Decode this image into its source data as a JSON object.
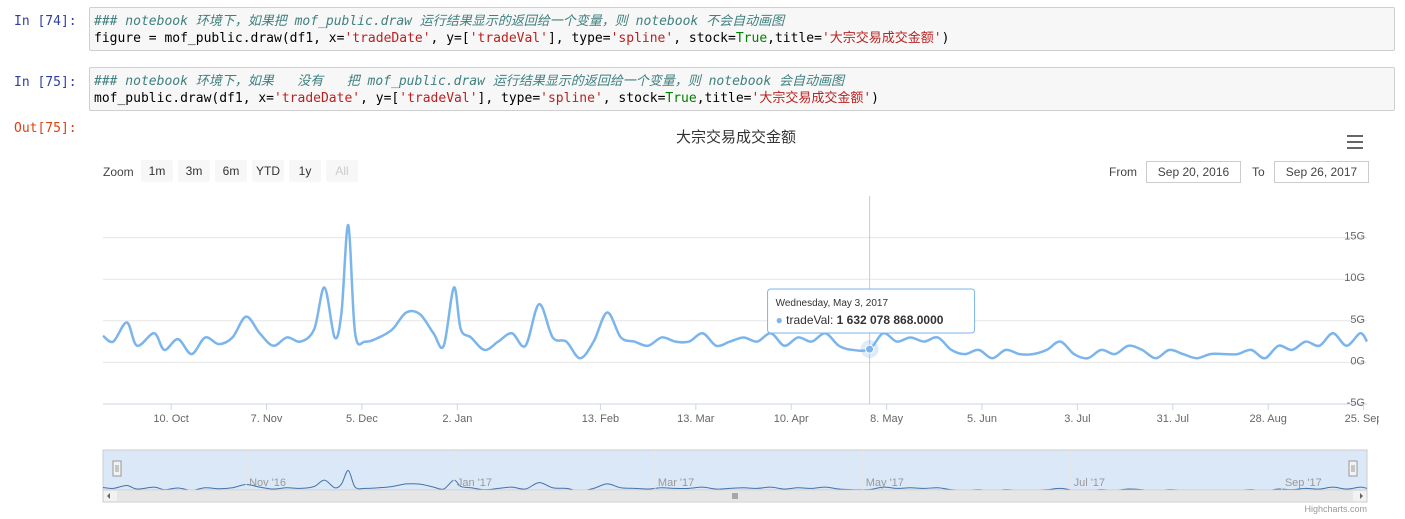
{
  "cells": [
    {
      "prompt": "In [74]:",
      "comment": "### notebook 环境下，如果把 mof_public.draw 运行结果显示的返回给一个变量，则 notebook 不会自动画图",
      "code": {
        "pre": "figure = mof_public.draw(df1, x=",
        "x": "'tradeDate'",
        "mid": ", y=[",
        "y": "'tradeVal'",
        "mid2": "], type=",
        "type": "'spline'",
        "mid3": ", stock=",
        "stock": "True",
        "mid4": ",title=",
        "title": "'大宗交易成交金额'",
        "post": ")"
      }
    },
    {
      "prompt": "In [75]:",
      "comment": "### notebook 环境下，如果   没有   把 mof_public.draw 运行结果显示的返回给一个变量，则 notebook 会自动画图",
      "code": {
        "pre": "mof_public.draw(df1, x=",
        "x": "'tradeDate'",
        "mid": ", y=[",
        "y": "'tradeVal'",
        "mid2": "], type=",
        "type": "'spline'",
        "mid3": ", stock=",
        "stock": "True",
        "mid4": ",title=",
        "title": "'大宗交易成交金额'",
        "post": ")"
      }
    }
  ],
  "out_prompt": "Out[75]:",
  "range_selector": {
    "zoom_label": "Zoom",
    "buttons": [
      "1m",
      "3m",
      "6m",
      "YTD",
      "1y",
      "All"
    ],
    "from_label": "From",
    "from_value": "Sep 20, 2016",
    "to_label": "To",
    "to_value": "Sep 26, 2017"
  },
  "menu_icon": "hamburger-menu-icon",
  "tooltip": {
    "date": "Wednesday, May 3, 2017",
    "series": "tradeVal",
    "value": "1 632 078 868.0000"
  },
  "credits": "Highcharts.com",
  "colors": {
    "series": "#7cb5ec",
    "navigator_fill": "#dbe8f8",
    "navigator_series": "#4572a7"
  },
  "chart_data": {
    "type": "line",
    "title": "大宗交易成交金额",
    "series": [
      {
        "name": "tradeVal",
        "x": [
          "2016-09-20",
          "2016-09-23",
          "2016-09-27",
          "2016-09-30",
          "2016-10-05",
          "2016-10-08",
          "2016-10-12",
          "2016-10-16",
          "2016-10-20",
          "2016-10-24",
          "2016-10-28",
          "2016-11-01",
          "2016-11-05",
          "2016-11-09",
          "2016-11-13",
          "2016-11-17",
          "2016-11-21",
          "2016-11-24",
          "2016-11-27",
          "2016-11-29",
          "2016-12-01",
          "2016-12-03",
          "2016-12-06",
          "2016-12-10",
          "2016-12-14",
          "2016-12-18",
          "2016-12-22",
          "2016-12-26",
          "2016-12-29",
          "2017-01-01",
          "2017-01-03",
          "2017-01-06",
          "2017-01-10",
          "2017-01-14",
          "2017-01-18",
          "2017-01-22",
          "2017-01-26",
          "2017-01-30",
          "2017-02-03",
          "2017-02-07",
          "2017-02-11",
          "2017-02-15",
          "2017-02-19",
          "2017-02-23",
          "2017-02-27",
          "2017-03-03",
          "2017-03-07",
          "2017-03-11",
          "2017-03-15",
          "2017-03-19",
          "2017-03-23",
          "2017-03-27",
          "2017-03-31",
          "2017-04-04",
          "2017-04-08",
          "2017-04-12",
          "2017-04-16",
          "2017-04-20",
          "2017-04-24",
          "2017-04-28",
          "2017-05-03",
          "2017-05-07",
          "2017-05-11",
          "2017-05-15",
          "2017-05-19",
          "2017-05-23",
          "2017-05-27",
          "2017-05-31",
          "2017-06-04",
          "2017-06-08",
          "2017-06-12",
          "2017-06-16",
          "2017-06-20",
          "2017-06-24",
          "2017-06-28",
          "2017-07-02",
          "2017-07-06",
          "2017-07-10",
          "2017-07-14",
          "2017-07-18",
          "2017-07-22",
          "2017-07-26",
          "2017-07-30",
          "2017-08-03",
          "2017-08-07",
          "2017-08-11",
          "2017-08-15",
          "2017-08-19",
          "2017-08-23",
          "2017-08-27",
          "2017-08-31",
          "2017-09-04",
          "2017-09-08",
          "2017-09-12",
          "2017-09-16",
          "2017-09-20",
          "2017-09-24",
          "2017-09-26"
        ],
        "values": [
          3.2,
          2.5,
          4.8,
          2.0,
          3.5,
          1.5,
          2.8,
          1.0,
          3.0,
          2.2,
          3.0,
          5.5,
          3.5,
          2.0,
          3.0,
          2.5,
          4.0,
          9.0,
          3.0,
          6.0,
          16.5,
          3.5,
          2.5,
          3.0,
          4.0,
          6.0,
          5.8,
          3.5,
          2.0,
          9.0,
          4.0,
          3.0,
          1.5,
          2.5,
          3.5,
          2.0,
          7.0,
          3.0,
          2.5,
          0.5,
          2.5,
          6.0,
          3.0,
          2.5,
          2.0,
          3.0,
          2.5,
          2.5,
          3.5,
          2.0,
          2.5,
          3.0,
          2.5,
          3.5,
          2.0,
          3.0,
          2.5,
          3.5,
          2.0,
          1.5,
          1.6,
          3.5,
          2.5,
          3.0,
          2.5,
          3.0,
          1.5,
          1.0,
          1.5,
          0.5,
          1.5,
          1.0,
          1.0,
          1.5,
          2.5,
          1.0,
          0.5,
          1.5,
          1.0,
          2.0,
          1.5,
          0.5,
          1.5,
          1.0,
          0.5,
          1.0,
          1.0,
          1.0,
          1.5,
          0.5,
          2.0,
          1.5,
          2.5,
          2.0,
          3.5,
          2.0,
          3.5,
          2.5
        ]
      }
    ],
    "xaxis_ticks": [
      "10. Oct",
      "7. Nov",
      "5. Dec",
      "2. Jan",
      "13. Feb",
      "13. Mar",
      "10. Apr",
      "8. May",
      "5. Jun",
      "3. Jul",
      "31. Jul",
      "28. Aug",
      "25. Sep"
    ],
    "yaxis_ticks": [
      "15G",
      "10G",
      "5G",
      "0G",
      "-5G"
    ],
    "navigator_ticks": [
      "Nov '16",
      "Jan '17",
      "Mar '17",
      "May '17",
      "Jul '17",
      "Sep '17"
    ],
    "ylim": [
      -5,
      20
    ],
    "grid": true,
    "legend": "none"
  }
}
